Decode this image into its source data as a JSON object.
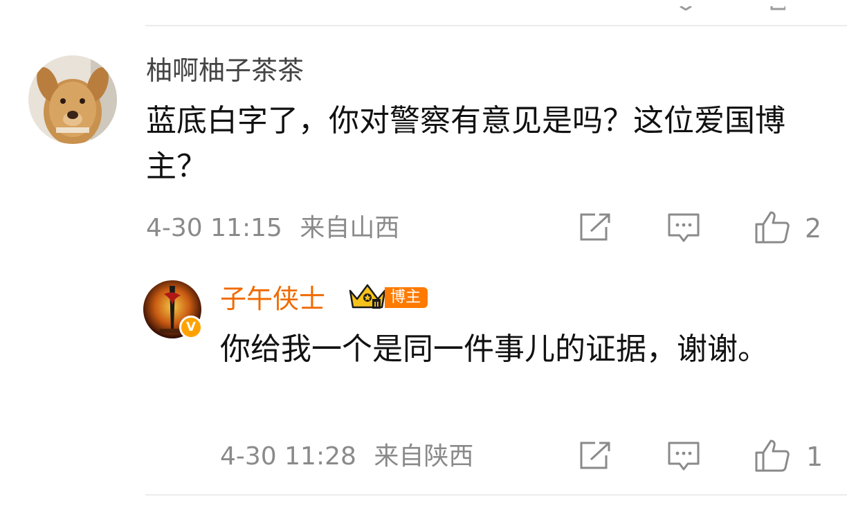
{
  "comment": {
    "username": "柚啊柚子茶茶",
    "text": "蓝底白字了，你对警察有意见是吗？这位爱国博主？",
    "time": "4-30 11:15",
    "location": "来自山西",
    "like_count": "2",
    "icons": {
      "share": "share-icon",
      "reply": "comment-icon",
      "like": "thumbs-up-icon"
    }
  },
  "reply": {
    "username": "子午侠士",
    "badge_label": "博主",
    "verified_mark": "V",
    "text": "你给我一个是同一件事儿的证据，谢谢。",
    "time": "4-30 11:28",
    "location": "来自陕西",
    "like_count": "1",
    "icons": {
      "share": "share-icon",
      "reply": "comment-icon",
      "like": "thumbs-up-icon",
      "crown": "crown-icon"
    }
  },
  "colors": {
    "username_primary": "#444444",
    "username_vip": "#f06a00",
    "meta_gray": "#8a8a8a",
    "divider": "#ececec",
    "badge_orange": "#ff7a00"
  }
}
